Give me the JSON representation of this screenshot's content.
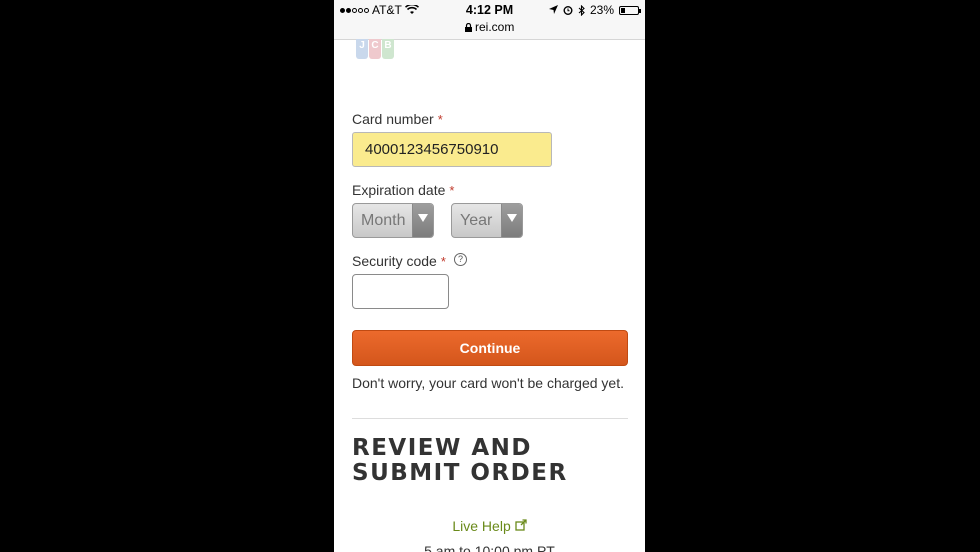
{
  "status_bar": {
    "carrier": "AT&T",
    "time": "4:12 PM",
    "url": "rei.com",
    "battery": "23%",
    "battery_level": 0.23
  },
  "form": {
    "card_number_label": "Card number",
    "required_mark": "*",
    "card_number_value": "4000123456750910",
    "expiration_label": "Expiration date",
    "month_select": "Month",
    "year_select": "Year",
    "security_label": "Security code",
    "help_glyph": "?",
    "security_value": "",
    "continue_label": "Continue",
    "note": "Don't worry, your card won't be charged yet."
  },
  "review": {
    "heading": "REVIEW AND SUBMIT ORDER"
  },
  "footer": {
    "live_help": "Live Help",
    "hours": "5 am to 10:00 pm PT"
  },
  "colors": {
    "accent": "#e05e22",
    "card_field_highlight": "#faeb8e",
    "link": "#6a8a1a",
    "required": "#c0392b"
  },
  "icons": [
    "wifi-icon",
    "location-icon",
    "alarm-icon",
    "bluetooth-icon",
    "battery-icon",
    "lock-icon",
    "jcb-logo",
    "help-icon",
    "external-link-icon"
  ]
}
